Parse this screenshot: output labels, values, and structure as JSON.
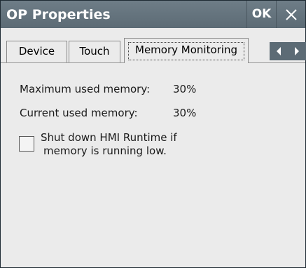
{
  "window": {
    "title": "OP Properties",
    "ok_label": "OK",
    "close_icon": "close-icon"
  },
  "tabs": [
    {
      "label": "Device"
    },
    {
      "label": "Touch"
    },
    {
      "label": "Memory Monitoring",
      "selected": true
    }
  ],
  "tab_scroll": {
    "left_icon": "arrow-left-icon",
    "right_icon": "arrow-right-icon"
  },
  "memory": {
    "max_label": "Maximum used memory:",
    "max_value": "30%",
    "current_label": "Current used memory:",
    "current_value": "30%"
  },
  "shutdown_option": {
    "line1": "Shut down HMI Runtime if",
    "line2": "memory is running low.",
    "checked": false
  },
  "colors": {
    "titlebar": "#5c6b75",
    "background": "#ebebeb",
    "title_text": "#ffffff"
  }
}
